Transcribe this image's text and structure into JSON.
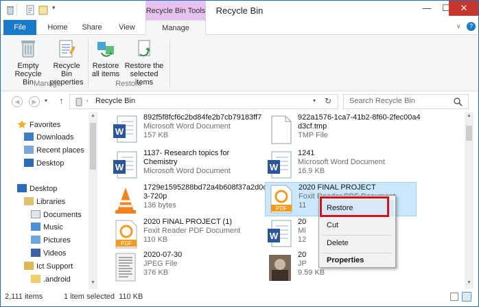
{
  "window": {
    "title": "Recycle Bin",
    "context_tab_header": "Recycle Bin Tools",
    "minimize": "—",
    "maximize": "☐",
    "close": "✕"
  },
  "tabs": [
    "File",
    "Home",
    "Share",
    "View",
    "Manage"
  ],
  "ribbon": {
    "empty": [
      "Empty",
      "Recycle Bin"
    ],
    "properties": [
      "Recycle Bin",
      "properties"
    ],
    "restore_all": [
      "Restore",
      "all items"
    ],
    "restore_selected": [
      "Restore the",
      "selected items"
    ],
    "group_manage": "Manage",
    "group_restore": "Restore"
  },
  "address": {
    "path": "Recycle Bin",
    "search_placeholder": "Search Recycle Bin"
  },
  "nav": [
    {
      "label": "Favorites",
      "icon": "star-icon"
    },
    {
      "label": "Downloads",
      "icon": "downloads-icon"
    },
    {
      "label": "Recent places",
      "icon": "recent-places-icon"
    },
    {
      "label": "Desktop",
      "icon": "desktop-icon"
    },
    {
      "label": "Desktop",
      "icon": "desktop-icon"
    },
    {
      "label": "Libraries",
      "icon": "libraries-icon"
    },
    {
      "label": "Documents",
      "icon": "documents-icon"
    },
    {
      "label": "Music",
      "icon": "music-icon"
    },
    {
      "label": "Pictures",
      "icon": "pictures-icon"
    },
    {
      "label": "Videos",
      "icon": "videos-icon"
    },
    {
      "label": "Ict Support",
      "icon": "user-folder-icon"
    },
    {
      "label": ".android",
      "icon": "folder-icon"
    }
  ],
  "files": [
    {
      "name": "892f5f8fcf6c2bd84fe2b7cb79183ff7",
      "type": "Microsoft Word Document",
      "size": "157 KB",
      "icon": "word-icon"
    },
    {
      "name": "922a1576-1ca7-41b2-8f60-2fec00a4",
      "name2": "d3cf.tmp",
      "type": "TMP File",
      "icon": "tmp-file-icon"
    },
    {
      "name": "1137- Research topics for",
      "name2": "Chemistry",
      "type": "Microsoft Word Document",
      "icon": "word-icon"
    },
    {
      "name": "1241",
      "type": "Microsoft Word Document",
      "size": "16.9 KB",
      "icon": "word-icon"
    },
    {
      "name": "1729e1595288bd72a4b608f37a2d0df",
      "name2": "3-720p",
      "size": "136 bytes",
      "icon": "vlc-icon"
    },
    {
      "name": "2020 FINAL PROJECT",
      "type": "Foxit Reader PDF Document",
      "size": "11",
      "icon": "pdf-icon"
    },
    {
      "name": "2020 FINAL PROJECT (1)",
      "type": "Foxit Reader PDF Document",
      "size": "110 KB",
      "icon": "pdf-icon"
    },
    {
      "name": "20",
      "type": "Mi",
      "size": "12",
      "icon": "word-icon"
    },
    {
      "name": "2020-07-30",
      "type": "JPEG File",
      "size": "376 KB",
      "icon": "jpeg-thumb-icon"
    },
    {
      "name": "20",
      "type": "JP",
      "size": "9.59 KB",
      "icon": "photo-thumb-icon"
    }
  ],
  "context_menu": [
    "Restore",
    "Cut",
    "Delete",
    "Properties"
  ],
  "status": {
    "count": "2,111 items",
    "selection": "1 item selected  110 KB"
  }
}
